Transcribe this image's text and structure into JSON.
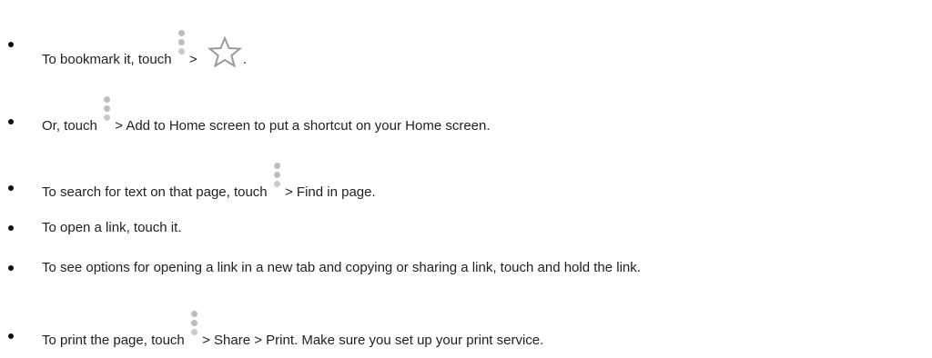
{
  "items": [
    {
      "before": "To bookmark it, touch",
      "after": " >",
      "icon2": "star-outline-icon",
      "end": "."
    },
    {
      "before": "Or, touch",
      "after": " > Add to Home screen to put a shortcut on your Home screen."
    },
    {
      "before": "To search for text on that page, touch",
      "after": " > Find in page."
    },
    {
      "text": "To open a link, touch it."
    },
    {
      "text": "To see options for opening a link in a new tab and copying or sharing a link, touch and hold the link."
    },
    {
      "before": "To print the page, touch",
      "after": " > Share > Print. Make sure you set up your print service."
    }
  ],
  "icons": {
    "menu": "more-vertical-icon",
    "star": "star-outline-icon"
  }
}
